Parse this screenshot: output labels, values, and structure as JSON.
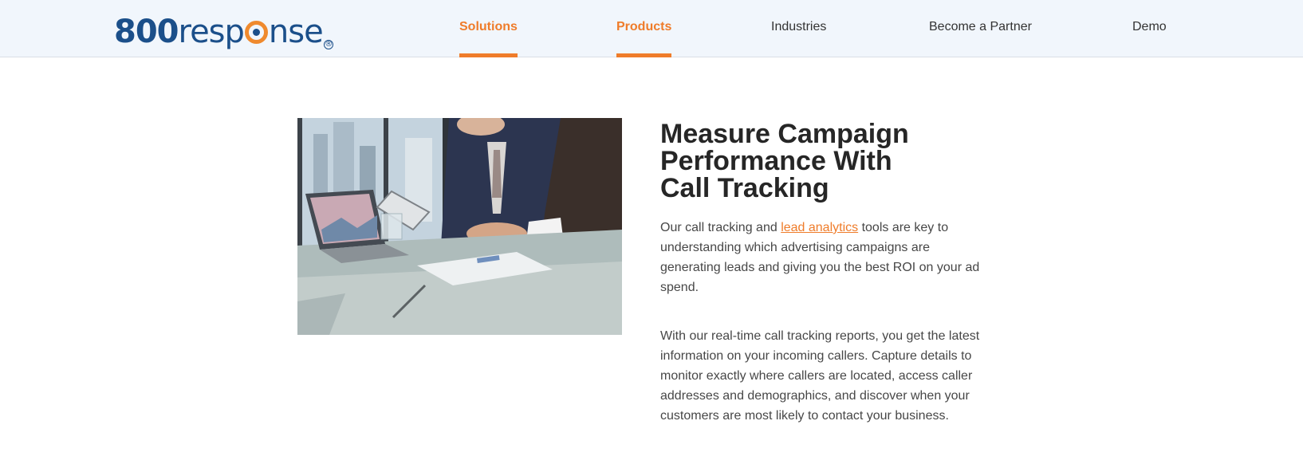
{
  "header": {
    "logo": {
      "number": "800",
      "word_before": "resp",
      "word_after": "nse",
      "registered": "®"
    },
    "nav": [
      {
        "label": "Solutions",
        "active": true
      },
      {
        "label": "Products",
        "active": true
      },
      {
        "label": "Industries",
        "active": false
      },
      {
        "label": "Become a Partner",
        "active": false
      },
      {
        "label": "Demo",
        "active": false
      }
    ]
  },
  "main": {
    "image_alt": "Business people reviewing analytics on a laptop and tablet at a glass table",
    "headline": "Measure Campaign Performance With Call Tracking",
    "intro": {
      "before": "Our call tracking and ",
      "link": "lead analytics",
      "after": " tools are key to understanding which advertising campaigns are generating leads and giving you the best ROI on your ad spend."
    },
    "details": "With our real-time call tracking reports, you get the latest information on your incoming callers. Capture details to monitor exactly where callers are located, access caller addresses and demographics, and discover when your customers are most likely to contact your business."
  },
  "colors": {
    "brand_blue": "#1b4f8a",
    "accent_orange": "#ef7c2a",
    "header_bg": "#f1f6fc"
  }
}
